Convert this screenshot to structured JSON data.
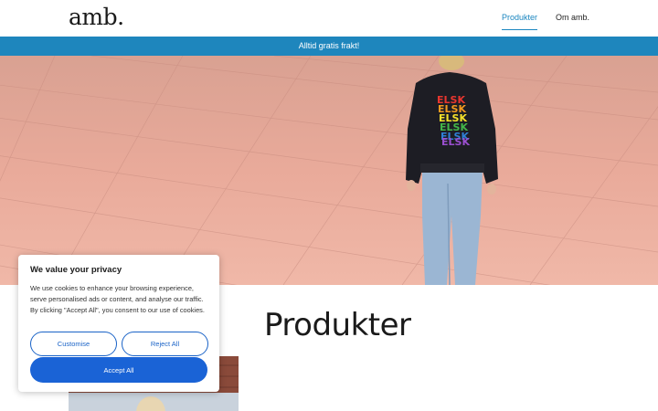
{
  "header": {
    "logo": "amb.",
    "nav": [
      {
        "label": "Produkter",
        "active": true
      },
      {
        "label": "Om amb.",
        "active": false
      }
    ]
  },
  "announcement": "Alltid gratis frakt!",
  "hero": {
    "sweater_print": "ELSK"
  },
  "section": {
    "title": "Produkter"
  },
  "cookie": {
    "title": "We value your privacy",
    "text": "We use cookies to enhance your browsing experience, serve personalised ads or content, and analyse our traffic. By clicking \"Accept All\", you consent to our use of cookies.",
    "customise_label": "Customise",
    "reject_label": "Reject All",
    "accept_label": "Accept All"
  },
  "colors": {
    "accent": "#1e86bd",
    "button_blue": "#1a63d6",
    "pavement": "#e9a898"
  }
}
